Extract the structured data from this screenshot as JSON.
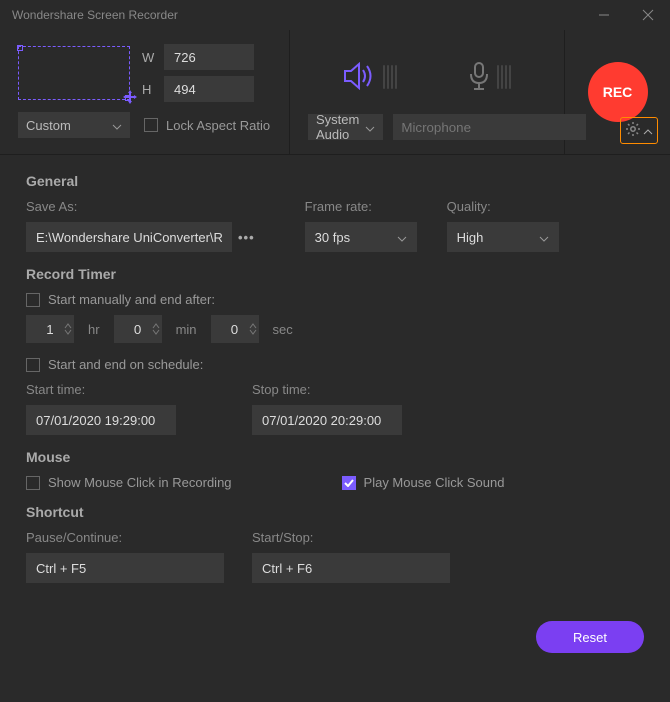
{
  "title": "Wondershare Screen Recorder",
  "area": {
    "w_label": "W",
    "w": "726",
    "h_label": "H",
    "h": "494",
    "preset": "Custom",
    "lock_label": "Lock Aspect Ratio",
    "lock_checked": false
  },
  "audio": {
    "system": "System Audio",
    "mic_placeholder": "Microphone"
  },
  "rec_label": "REC",
  "general": {
    "heading": "General",
    "save_as_label": "Save As:",
    "save_as": "E:\\Wondershare UniConverter\\Recor",
    "frame_rate_label": "Frame rate:",
    "frame_rate": "30 fps",
    "quality_label": "Quality:",
    "quality": "High"
  },
  "timer": {
    "heading": "Record Timer",
    "start_manual_label": "Start manually and end after:",
    "start_manual_checked": false,
    "hr": "1",
    "hr_unit": "hr",
    "min": "0",
    "min_unit": "min",
    "sec": "0",
    "sec_unit": "sec",
    "schedule_label": "Start and end on schedule:",
    "schedule_checked": false,
    "start_time_label": "Start time:",
    "start_time": "07/01/2020 19:29:00",
    "stop_time_label": "Stop time:",
    "stop_time": "07/01/2020 20:29:00"
  },
  "mouse": {
    "heading": "Mouse",
    "show_click_label": "Show Mouse Click in Recording",
    "show_click_checked": false,
    "play_sound_label": "Play Mouse Click Sound",
    "play_sound_checked": true
  },
  "shortcut": {
    "heading": "Shortcut",
    "pause_label": "Pause/Continue:",
    "pause": "Ctrl + F5",
    "startstop_label": "Start/Stop:",
    "startstop": "Ctrl + F6"
  },
  "reset_label": "Reset"
}
